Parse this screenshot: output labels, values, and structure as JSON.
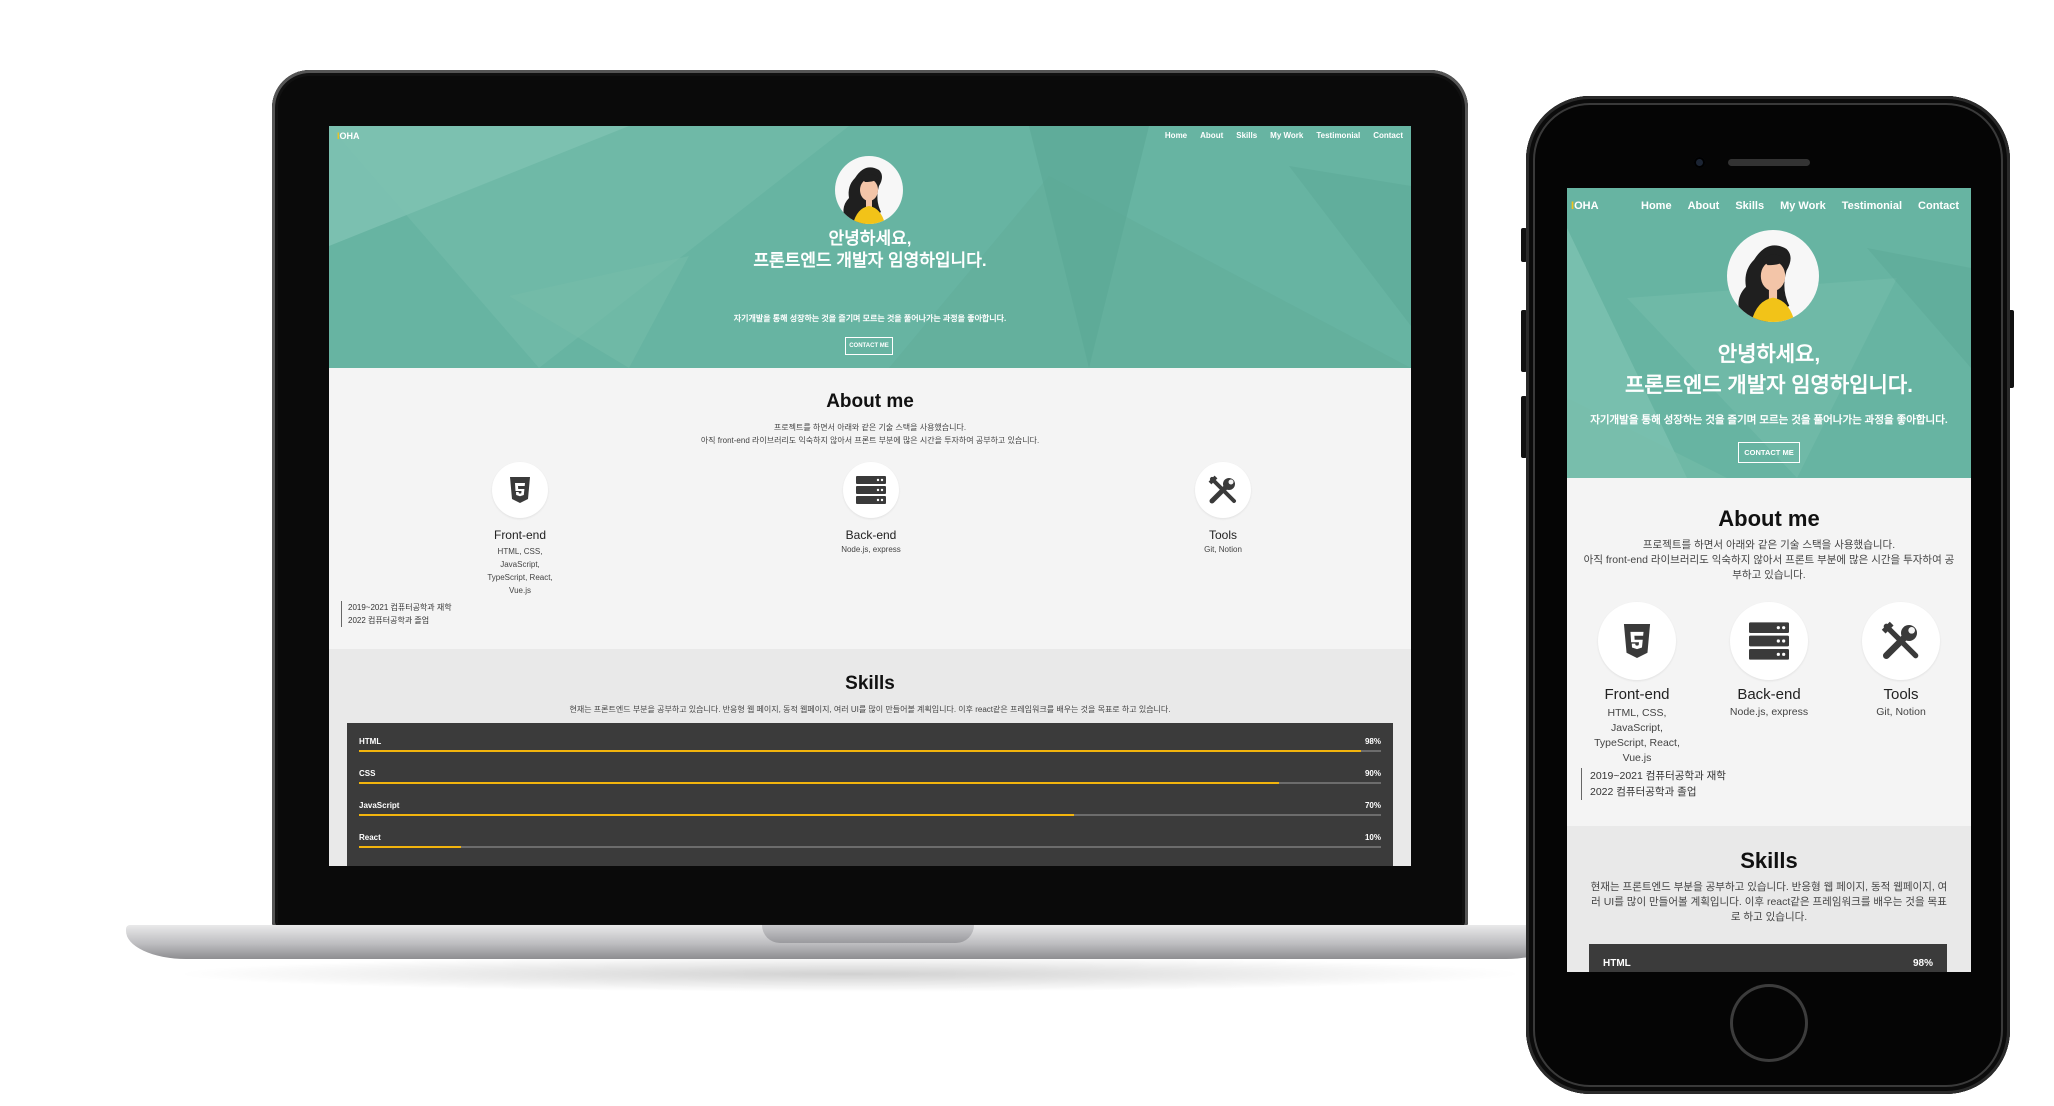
{
  "site": {
    "logo_prefix": "I",
    "logo_rest": "OHA",
    "nav": [
      "Home",
      "About",
      "Skills",
      "My Work",
      "Testimonial",
      "Contact"
    ],
    "hero_line1": "안녕하세요,",
    "hero_line2": "프론트엔드 개발자 임영하입니다.",
    "hero_sub": "자기개발을 통해 성장하는 것을 즐기며 모르는 것을 풀어나가는 과정을 좋아합니다.",
    "cta_label": "CONTACT ME",
    "about": {
      "title": "About me",
      "desc1": "프로젝트를 하면서 아래와 같은 기술 스택을 사용했습니다.",
      "desc2": "아직 front-end 라이브러리도 익숙하지 않아서 프론트 부분에 많은 시간을 투자하여 공부하고 있습니다.",
      "skills": [
        {
          "icon": "html5-icon",
          "name": "Front-end",
          "tech": "HTML, CSS, JavaScript, TypeScript, React, Vue.js"
        },
        {
          "icon": "server-icon",
          "name": "Back-end",
          "tech": "Node.js, express"
        },
        {
          "icon": "tools-icon",
          "name": "Tools",
          "tech": "Git, Notion"
        }
      ],
      "education": [
        "2019~2021 컴퓨터공학과 재학",
        "2022 컴퓨터공학과 졸업"
      ]
    },
    "skills": {
      "title": "Skills",
      "desc": "현재는 프론트엔드 부분을 공부하고 있습니다. 반응형 웹 페이지, 동적 웹페이지, 여러 UI를 많이 만들어볼 계획입니다. 이후 react같은 프레임워크를 배우는 것을 목표로 하고 있습니다.",
      "bars": [
        {
          "label": "HTML",
          "pct_text": "98%",
          "value": 98
        },
        {
          "label": "CSS",
          "pct_text": "90%",
          "value": 90
        },
        {
          "label": "JavaScript",
          "pct_text": "70%",
          "value": 70
        },
        {
          "label": "React",
          "pct_text": "10%",
          "value": 10
        }
      ]
    },
    "colors": {
      "hero": "#67b4a2",
      "accent": "#f2b40d",
      "bars_bg": "#3b3b3b"
    }
  }
}
